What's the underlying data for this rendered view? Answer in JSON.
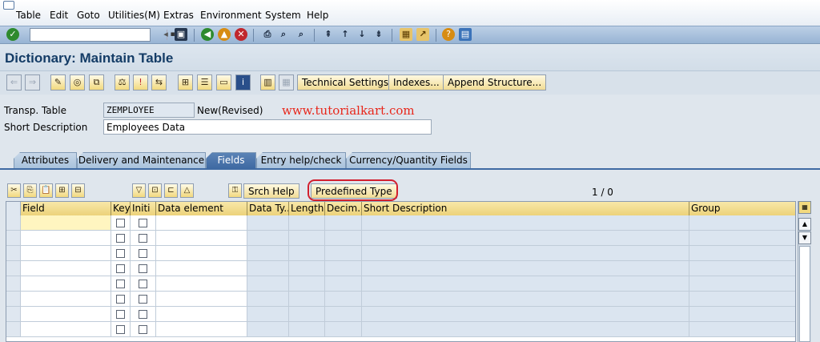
{
  "menu": [
    "Table",
    "Edit",
    "Goto",
    "Utilities(M)",
    "Extras",
    "Environment",
    "System",
    "Help"
  ],
  "page_title": "Dictionary: Maintain Table",
  "app_toolbar": {
    "technical_settings": "Technical Settings",
    "indexes": "Indexes...",
    "append_structure": "Append Structure..."
  },
  "header": {
    "table_label": "Transp. Table",
    "table_value": "ZEMPLOYEE",
    "table_status": "New(Revised)",
    "desc_label": "Short Description",
    "desc_value": "Employees Data",
    "watermark": "www.tutorialkart.com"
  },
  "tabs": [
    "Attributes",
    "Delivery and Maintenance",
    "Fields",
    "Entry help/check",
    "Currency/Quantity Fields"
  ],
  "active_tab": "Fields",
  "table_toolbar": {
    "srch_help": "Srch Help",
    "predefined_type": "Predefined Type",
    "counter": "1  /  0"
  },
  "columns": [
    "Field",
    "Key",
    "Initi",
    "Data element",
    "Data Ty...",
    "Length",
    "Decim...",
    "Short Description",
    "Group"
  ],
  "row_count": 8,
  "colors": {
    "title": "#143c66",
    "active_tab": "#3f6aa3",
    "header_bg": "#ecd27a",
    "highlight": "#d21f2e",
    "watermark": "#e8261a"
  }
}
